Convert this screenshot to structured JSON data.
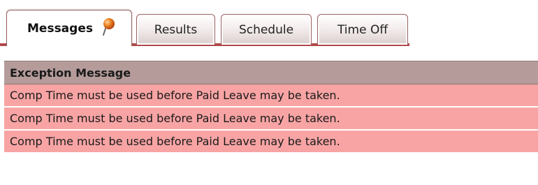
{
  "tabs": {
    "messages": {
      "label": "Messages",
      "active": true,
      "alert_icon": "pin-alert-icon"
    },
    "results": {
      "label": "Results"
    },
    "schedule": {
      "label": "Schedule"
    },
    "time_off": {
      "label": "Time Off"
    }
  },
  "table": {
    "header": {
      "label": "Exception Message"
    },
    "rows": [
      {
        "message": "Comp Time must be used before Paid Leave may be taken."
      },
      {
        "message": "Comp Time must be used before Paid Leave may be taken."
      },
      {
        "message": "Comp Time must be used before Paid Leave may be taken."
      }
    ]
  },
  "colors": {
    "tab_underline": "#b04a4a",
    "header_bg": "#b59c9a",
    "row_bg": "#f8a4a4",
    "alert_orange": "#e8741a"
  }
}
